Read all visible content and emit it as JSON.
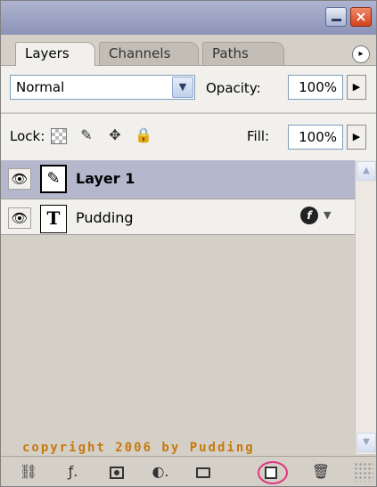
{
  "window": {
    "minimize_label": "_",
    "close_label": "×"
  },
  "tabs": [
    {
      "label": "Layers",
      "active": true
    },
    {
      "label": "Channels",
      "active": false
    },
    {
      "label": "Paths",
      "active": false
    }
  ],
  "panel_menu_icon": "▸",
  "blend": {
    "mode": "Normal",
    "dropdown_icon": "▼",
    "opacity_label": "Opacity:",
    "opacity_value": "100%",
    "stepper_icon": "▶"
  },
  "lock": {
    "label": "Lock:",
    "icons": [
      "transparency-lock-icon",
      "paintbrush-lock-icon",
      "move-lock-icon",
      "padlock-icon"
    ],
    "paint_glyph": "✎",
    "move_glyph": "✥",
    "all_glyph": "🔒",
    "fill_label": "Fill:",
    "fill_value": "100%",
    "stepper_icon": "▶"
  },
  "layers": [
    {
      "name": "Layer 1",
      "selected": true,
      "visible": true,
      "eye_glyph": "👁",
      "thumb_glyph": "✎",
      "type": "brush"
    },
    {
      "name": "Pudding",
      "selected": false,
      "visible": true,
      "eye_glyph": "👁",
      "thumb_glyph": "T",
      "type": "text",
      "fx_glyph": "f",
      "fx_arrow": "▼"
    }
  ],
  "scrollbar": {
    "up_icon": "▲",
    "down_icon": "▼"
  },
  "watermark": "copyright 2006 by Pudding",
  "bottom_bar": {
    "link_glyph": "⛓",
    "style_glyph": "ƒ.",
    "adjust_glyph": "◐.",
    "trash_glyph": "🗑",
    "highlighted": "new-layer-button"
  },
  "colors": {
    "title_bar": "#9aa0c4",
    "selected_row": "#b5b8cc",
    "watermark": "#c8780e",
    "highlight_circle": "#e0357f",
    "panel_bg": "#d4d0c8"
  }
}
